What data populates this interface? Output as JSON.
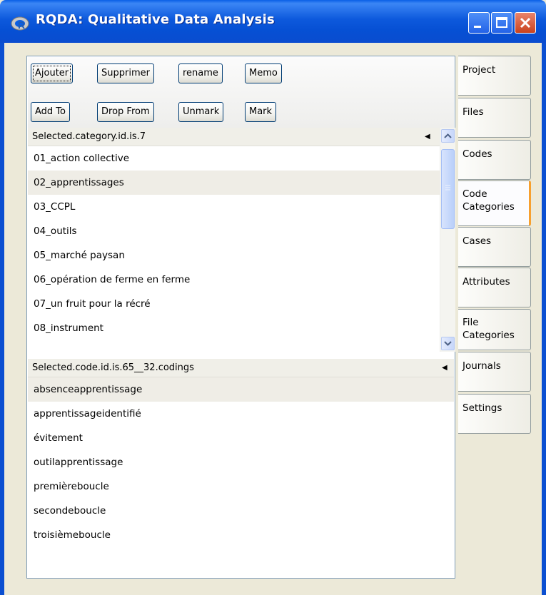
{
  "window": {
    "title": "RQDA: Qualitative Data Analysis"
  },
  "toolbar": {
    "row1": [
      "Ajouter",
      "Supprimer",
      "rename",
      "Memo"
    ],
    "row2": [
      "Add To",
      "Drop From",
      "Unmark",
      "Mark"
    ]
  },
  "categories_panel": {
    "header": "Selected.category.id.is.7",
    "selected_index": 1,
    "items": [
      "01_action collective",
      "02_apprentissages",
      "03_CCPL",
      "04_outils",
      "05_marché paysan",
      "06_opération de ferme en ferme",
      "07_un fruit pour la récré",
      "08_instrument"
    ]
  },
  "codings_panel": {
    "header": "Selected.code.id.is.65__32.codings",
    "selected_index": 0,
    "items": [
      "absenceapprentissage",
      "apprentissageidentifié",
      "évitement",
      "outilapprentissage",
      "premièreboucle",
      "secondeboucle",
      "troisièmeboucle"
    ]
  },
  "tabs": {
    "active_index": 3,
    "items": [
      "Project",
      "Files",
      "Codes",
      "Code Categories",
      "Cases",
      "Attributes",
      "File Categories",
      "Journals",
      "Settings"
    ]
  },
  "icons": {
    "app": "r-logo-icon",
    "minimize": "minimize-icon",
    "maximize": "maximize-icon",
    "close": "close-icon",
    "sort": "sort-arrow-icon",
    "scroll_up": "scroll-up-arrow-icon",
    "scroll_down": "scroll-down-arrow-icon"
  },
  "colors": {
    "titlebar": "#0a5fe6",
    "active_tab_accent": "#f7a02e",
    "selection": "#efede6"
  }
}
